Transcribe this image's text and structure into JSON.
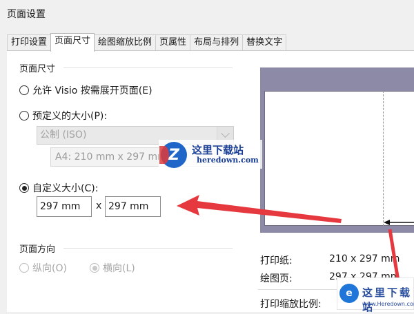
{
  "window": {
    "title": "页面设置"
  },
  "tabs": [
    {
      "label": "打印设置"
    },
    {
      "label": "页面尺寸",
      "active": true
    },
    {
      "label": "绘图缩放比例"
    },
    {
      "label": "页属性"
    },
    {
      "label": "布局与排列"
    },
    {
      "label": "替换文字"
    }
  ],
  "page_size": {
    "group_title": "页面尺寸",
    "option_expand": "允许 Visio 按需展开页面(E)",
    "option_predefined": "预定义的大小(P):",
    "predefined_standard": "公制 (ISO)",
    "predefined_size": "A4:  210 mm x 297 mm",
    "option_custom": "自定义大小(C):",
    "custom_width": "297 mm",
    "custom_times": "x",
    "custom_height": "297 mm",
    "selected": "custom"
  },
  "orientation": {
    "group_title": "页面方向",
    "portrait": "纵向(O)",
    "landscape": "横向(L)",
    "selected": "landscape",
    "disabled": true
  },
  "info": {
    "paper_label": "打印纸:",
    "paper_value": "210 x 297 mm",
    "drawing_label": "绘图页:",
    "drawing_value": "297 x 297 mm",
    "scale_label": "打印缩放比例:"
  },
  "watermarks": {
    "top_name": "这里下载站",
    "top_url": "heredown.com",
    "bottom_name": "这里下载站",
    "bottom_url": "www.Heredown.com"
  },
  "colors": {
    "preview_background": "#8c8aa6",
    "annotation_arrow": "#e5393f"
  }
}
